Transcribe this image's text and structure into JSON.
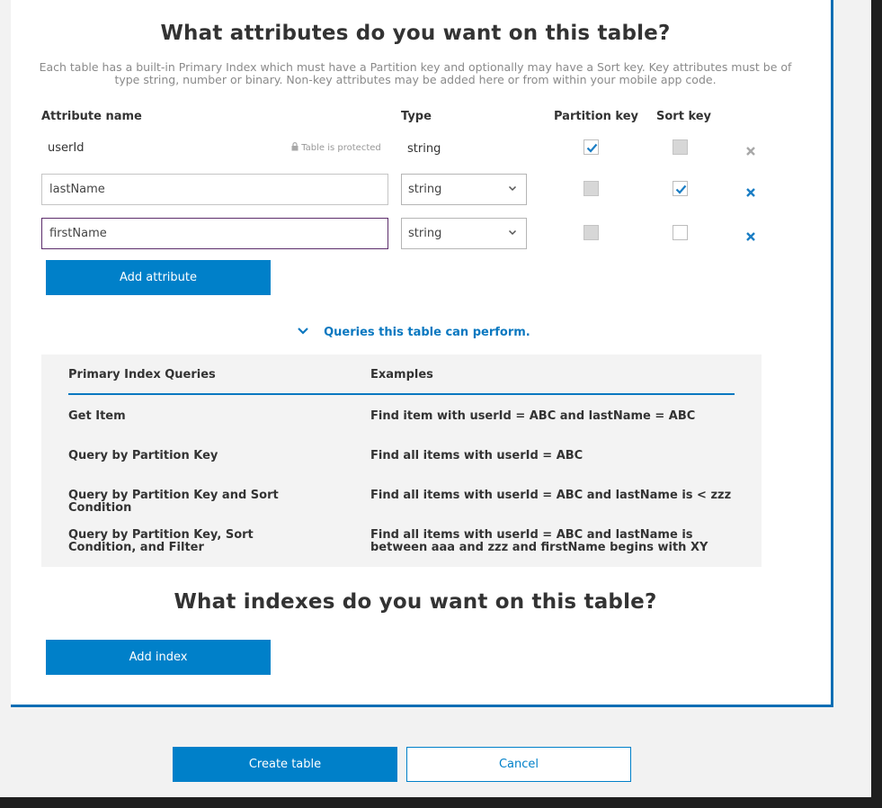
{
  "heading": "What attributes do you want on this table?",
  "description": "Each table has a built-in Primary Index which must have a Partition key and optionally may have a Sort key. Key attributes must be of type string, number or binary. Non-key attributes may be added here or from within your mobile app code.",
  "columns": {
    "attribute_name": "Attribute name",
    "type": "Type",
    "partition_key": "Partition key",
    "sort_key": "Sort key"
  },
  "attributes": [
    {
      "name": "userId",
      "type": "string",
      "protected_label": "Table is protected",
      "partition_key": true,
      "sort_key": false,
      "editable": false
    },
    {
      "name": "lastName",
      "type": "string",
      "partition_key": false,
      "sort_key": true,
      "editable": true
    },
    {
      "name": "firstName",
      "type": "string",
      "partition_key": false,
      "sort_key": false,
      "editable": true
    }
  ],
  "add_attribute_label": "Add attribute",
  "queries_toggle_label": "Queries this table can perform.",
  "queries_table": {
    "headers": [
      "Primary Index Queries",
      "Examples"
    ],
    "rows": [
      {
        "query": "Get Item",
        "example": "Find item with userId = ABC and lastName = ABC"
      },
      {
        "query": "Query by Partition Key",
        "example": "Find all items with userId = ABC"
      },
      {
        "query": "Query by Partition Key and Sort Condition",
        "example": "Find all items with userId = ABC and lastName is < zzz"
      },
      {
        "query": "Query by Partition Key, Sort Condition, and Filter",
        "example": "Find all items with userId = ABC and lastName is between aaa and zzz and firstName begins with XY"
      }
    ]
  },
  "indexes_heading": "What indexes do you want on this table?",
  "add_index_label": "Add index",
  "footer": {
    "create_label": "Create table",
    "cancel_label": "Cancel"
  },
  "colors": {
    "primary": "#0080c9",
    "check": "#1a7dc4",
    "panel_border": "#0a6eb4"
  },
  "icons": [
    "lock-icon",
    "checkmark-icon",
    "remove-icon",
    "chevron-down-icon"
  ]
}
